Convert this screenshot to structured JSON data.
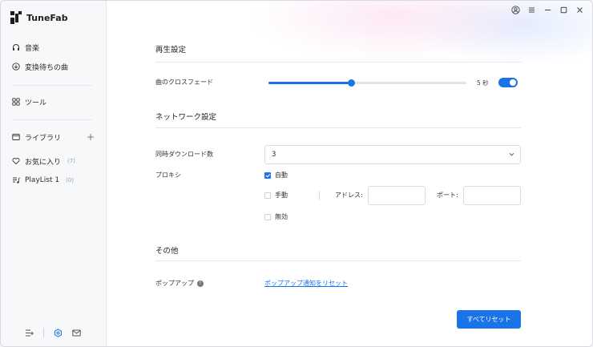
{
  "app": {
    "name": "TuneFab"
  },
  "sidebar": {
    "music": "音楽",
    "converting": "変換待ちの曲",
    "tools": "ツール",
    "library": "ライブラリ",
    "favorites": {
      "label": "お気に入り",
      "count": "(7)"
    },
    "playlist1": {
      "label": "PlayList 1",
      "count": "(0)"
    }
  },
  "playback": {
    "title": "再生設定",
    "crossfade_label": "曲のクロスフェード",
    "crossfade_value": "5 秒",
    "crossfade_fraction": 0.42,
    "crossfade_enabled": true
  },
  "network": {
    "title": "ネットワーク設定",
    "concurrent_label": "同時ダウンロード数",
    "concurrent_value": "3",
    "proxy_label": "プロキシ",
    "proxy_auto": "自動",
    "proxy_manual": "手動",
    "address_label": "アドレス:",
    "port_label": "ポート:",
    "proxy_disabled": "無効",
    "proxy_selected": "auto"
  },
  "other": {
    "title": "その他",
    "popup_label": "ポップアップ",
    "popup_link": "ポップアップ通知をリセット",
    "reset_all": "すべてリセット"
  },
  "colors": {
    "accent": "#1a73e8"
  }
}
